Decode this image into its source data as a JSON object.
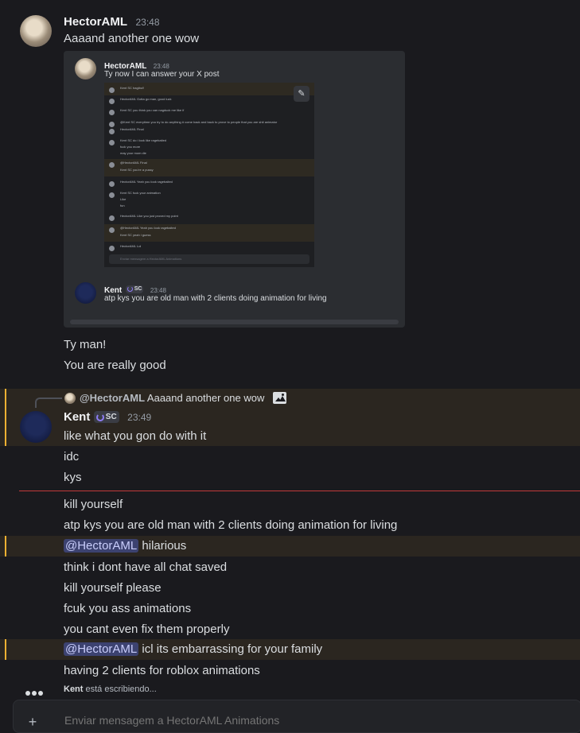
{
  "colors": {
    "background": "#1a1a1e",
    "highlight": "#2b2620",
    "highlight_bar": "#f0b132",
    "mention": "#3c4270",
    "separator": "#c23a3a"
  },
  "msg1": {
    "author": "HectorAML",
    "time": "23:48",
    "text": "Aaaand another one wow",
    "attachment": {
      "inner_author": "HectorAML",
      "inner_time": "23:48",
      "inner_text": "Ty now I can answer your X post",
      "inner_reply_author": "Kent",
      "inner_reply_badge": "SC",
      "inner_reply_time": "23:48",
      "inner_reply_text": "atp kys you are old man with 2 clients doing animation for living",
      "mini_lines": [
        "Kent SC  hagibo!!",
        "HectorAML  Gotta go man, good luck",
        "Kent SC  you think you can nagduck me like if",
        "@Kent SC  everytime you try to do anything # come back and back to prove to people that you are shit animator",
        "HectorAML  Final",
        "Kent SC  do i look like ragebaited",
        "fuck you more",
        "may your mom die",
        "@HectorAML  Final",
        "Kent SC  you're a pussy",
        "HectorAML  Yeah you look ragebaited",
        "Kent SC  fuck your animation",
        "Like",
        "fun",
        "HectorAML  Like you just proved my point",
        "@HectorAML  Yeah you look ragebaited",
        "Kent SC  yeah i guess",
        "HectorAML  Lol",
        "Enviar mensagem a HectorAML Animations"
      ]
    },
    "followups": [
      "Ty man!",
      "You are really good"
    ]
  },
  "msg2": {
    "reply_author": "@HectorAML",
    "reply_text": "Aaaand another one wow",
    "author": "Kent",
    "badge": "SC",
    "time": "23:49",
    "lines": [
      "like what you gon do with it",
      "idc",
      "kys"
    ]
  },
  "after_sep": [
    {
      "text": "kill yourself"
    },
    {
      "text": "atp kys you are old man with 2 clients doing animation for living"
    },
    {
      "mention": "@HectorAML",
      "text": " hilarious",
      "highlight": true
    },
    {
      "text": "think i dont have all chat saved"
    },
    {
      "text": "kill yourself please"
    },
    {
      "text": "fcuk you ass animations"
    },
    {
      "text": "you cant even fix them properly"
    },
    {
      "mention": "@HectorAML",
      "text": " icl its embarrassing for your family",
      "highlight": true
    },
    {
      "text": "having 2 clients for roblox animations"
    }
  ],
  "typing": {
    "user": "Kent",
    "text": " está escribiendo..."
  },
  "composer": {
    "placeholder": "Enviar mensagem a HectorAML Animations"
  }
}
